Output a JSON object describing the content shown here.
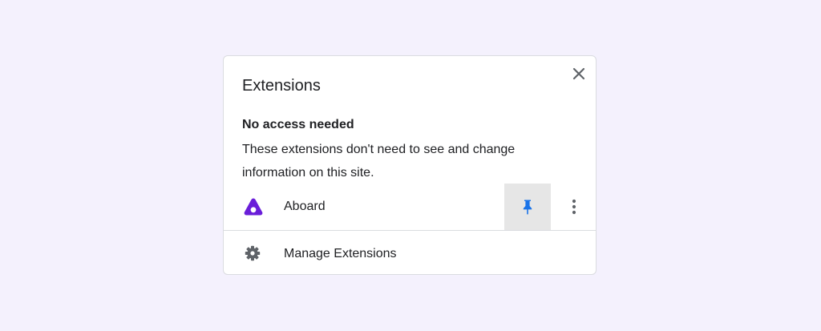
{
  "popup": {
    "title": "Extensions",
    "close_icon": "close-icon"
  },
  "section": {
    "heading": "No access needed",
    "description": "These extensions don't need to see and change information on this site."
  },
  "extensions": [
    {
      "name": "Aboard",
      "icon": "aboard-logo-icon",
      "pinned": true,
      "pin_icon": "pin-icon",
      "more_icon": "more-vertical-icon"
    }
  ],
  "footer": {
    "manage_label": "Manage Extensions",
    "manage_icon": "gear-icon"
  },
  "colors": {
    "background": "#f4f1fd",
    "brand_purple": "#6a1ed9",
    "pin_blue": "#1a73e8",
    "icon_gray": "#5f6368",
    "text": "#202124",
    "divider": "#dadce0",
    "pin_highlight": "#e6e6e6"
  }
}
